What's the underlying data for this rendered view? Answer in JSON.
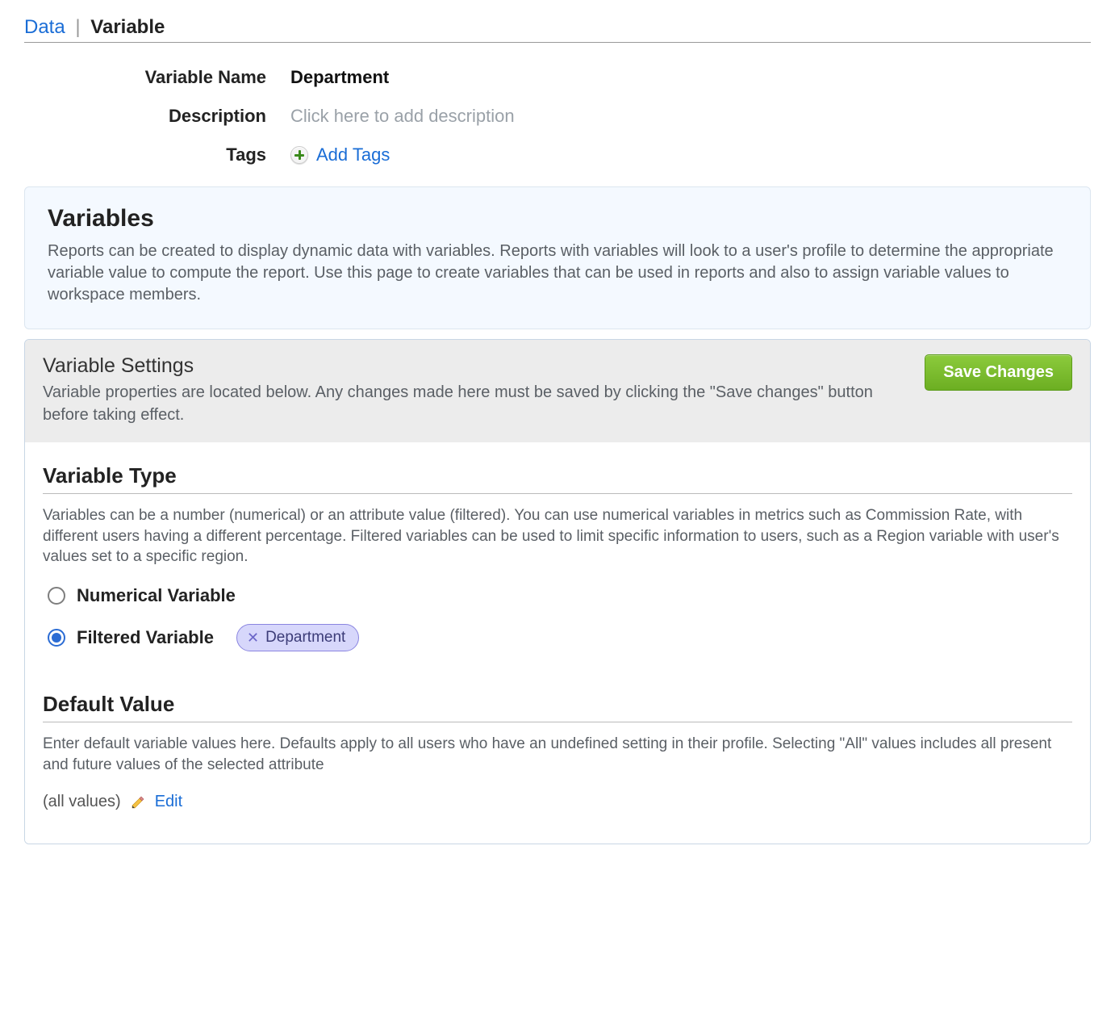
{
  "breadcrumb": {
    "root": "Data",
    "current": "Variable"
  },
  "meta": {
    "name_label": "Variable Name",
    "name_value": "Department",
    "description_label": "Description",
    "description_placeholder": "Click here to add description",
    "tags_label": "Tags",
    "add_tags_label": "Add Tags"
  },
  "info": {
    "title": "Variables",
    "body": "Reports can be created to display dynamic data with variables. Reports with variables will look to a user's profile to determine the appropriate variable value to compute the report. Use this page to create variables that can be used in reports and also to assign variable values to workspace members."
  },
  "settings": {
    "title": "Variable Settings",
    "description": "Variable properties are located below. Any changes made here must be saved by clicking the \"Save changes\" button before taking effect.",
    "save_label": "Save Changes"
  },
  "type_section": {
    "title": "Variable Type",
    "description": "Variables can be a number (numerical) or an attribute value (filtered). You can use numerical variables in metrics such as Commission Rate, with different users having a different percentage. Filtered variables can be used to limit specific information to users, such as a Region variable with user's values set to a specific region.",
    "option_numerical": "Numerical Variable",
    "option_filtered": "Filtered Variable",
    "selected": "filtered",
    "filter_pill": "Department"
  },
  "default_section": {
    "title": "Default Value",
    "description": "Enter default variable values here. Defaults apply to all users who have an undefined setting in their profile. Selecting \"All\" values includes all present and future values of the selected attribute",
    "value_display": "(all values)",
    "edit_label": "Edit"
  }
}
